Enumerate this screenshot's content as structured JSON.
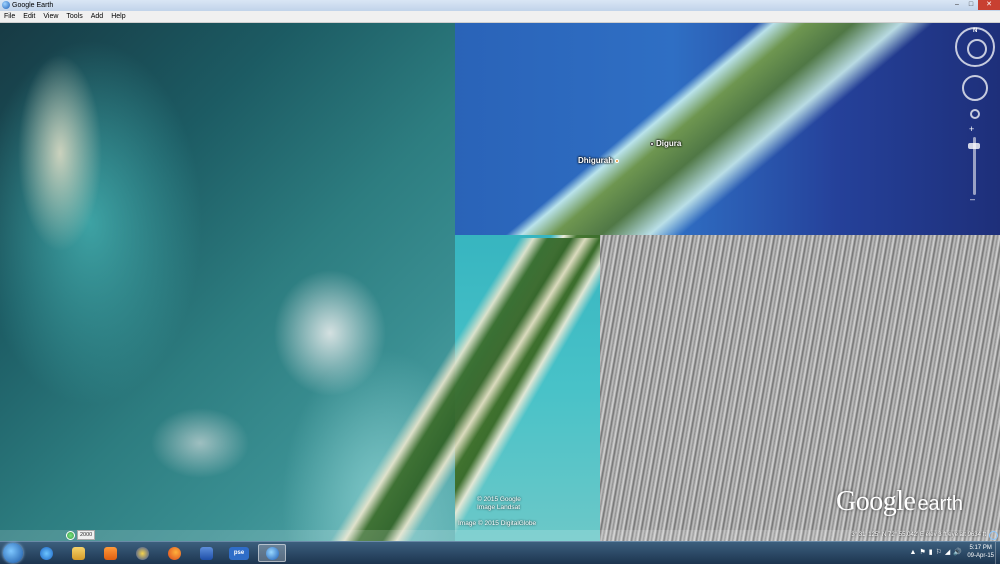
{
  "window": {
    "title": "Google Earth",
    "minimize_label": "–",
    "maximize_label": "□",
    "close_label": "✕"
  },
  "menu": {
    "items": [
      "File",
      "Edit",
      "View",
      "Tools",
      "Add",
      "Help"
    ]
  },
  "map": {
    "places": [
      {
        "name": "Dhigurah"
      },
      {
        "name": "Digura"
      }
    ],
    "attributions": [
      "© 2015 Google",
      "Image Landsat",
      "Image © 2015 DigitalGlobe"
    ],
    "logo": {
      "word1": "Google",
      "word2": "earth"
    },
    "history": {
      "year": "2000"
    },
    "nav": {
      "north_label": "N",
      "zoom_in": "+",
      "zoom_out": "–"
    }
  },
  "status": {
    "text": "3° 31' 125\" N   72° 55.042' E   elev   3 ft      eye alt   9634 ft"
  },
  "taskbar": {
    "apps": [
      "Internet Explorer",
      "Windows Explorer",
      "Media Player",
      "App",
      "Firefox",
      "Word",
      "pse",
      "Google Earth"
    ],
    "pse_label": "pse",
    "tray": [
      "▲",
      "⚑",
      "▮",
      "⚐",
      "◢",
      "🔊"
    ],
    "time": "5:17 PM",
    "date": "09-Apr-15"
  }
}
